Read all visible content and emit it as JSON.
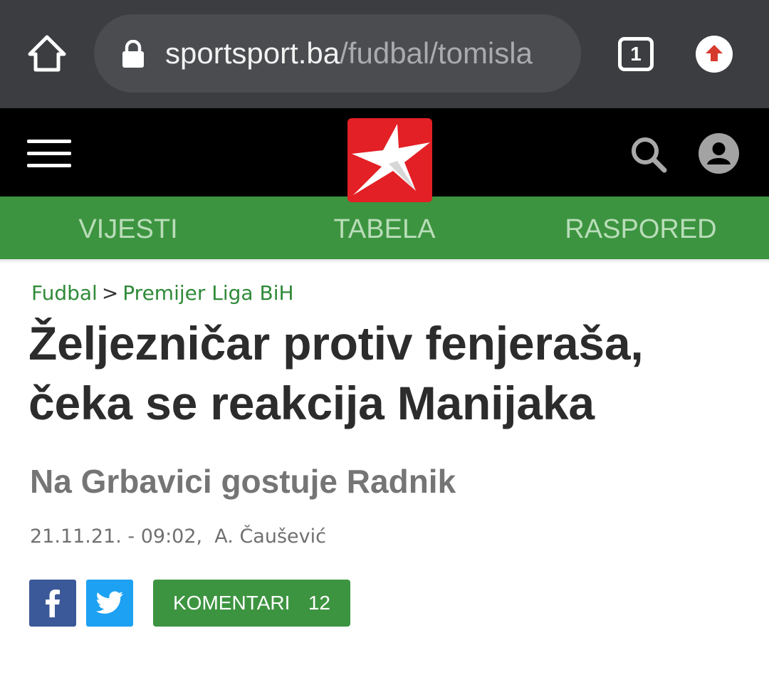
{
  "browser": {
    "url_domain": "sportsport.ba",
    "url_path": "/fudbal/tomisla",
    "tab_count": "1",
    "icons": {
      "home": "home-icon",
      "lock": "lock-icon",
      "update": "update-arrow-icon"
    }
  },
  "header": {
    "icons": {
      "menu": "hamburger-menu-icon",
      "logo": "star-logo",
      "search": "search-icon",
      "account": "account-icon"
    },
    "colors": {
      "logo_red": "#e32025",
      "header_bg": "#000000"
    }
  },
  "nav": {
    "tabs": [
      "VIJESTI",
      "TABELA",
      "RASPORED"
    ],
    "color": "#3d9440"
  },
  "article": {
    "breadcrumb": {
      "section": "Fudbal",
      "separator": ">",
      "subsection": "Premijer Liga BiH"
    },
    "headline_line1": "Željezničar protiv fenjeraša,",
    "headline_line2": "čeka se reakcija Manijaka",
    "subheadline": "Na Grbavici gostuje Radnik",
    "date": "21.11.21. - 09:02,",
    "author": "A. Čaušević"
  },
  "share": {
    "facebook_icon": "facebook-icon",
    "twitter_icon": "twitter-icon",
    "comments_label": "KOMENTARI",
    "comments_count": "12"
  }
}
